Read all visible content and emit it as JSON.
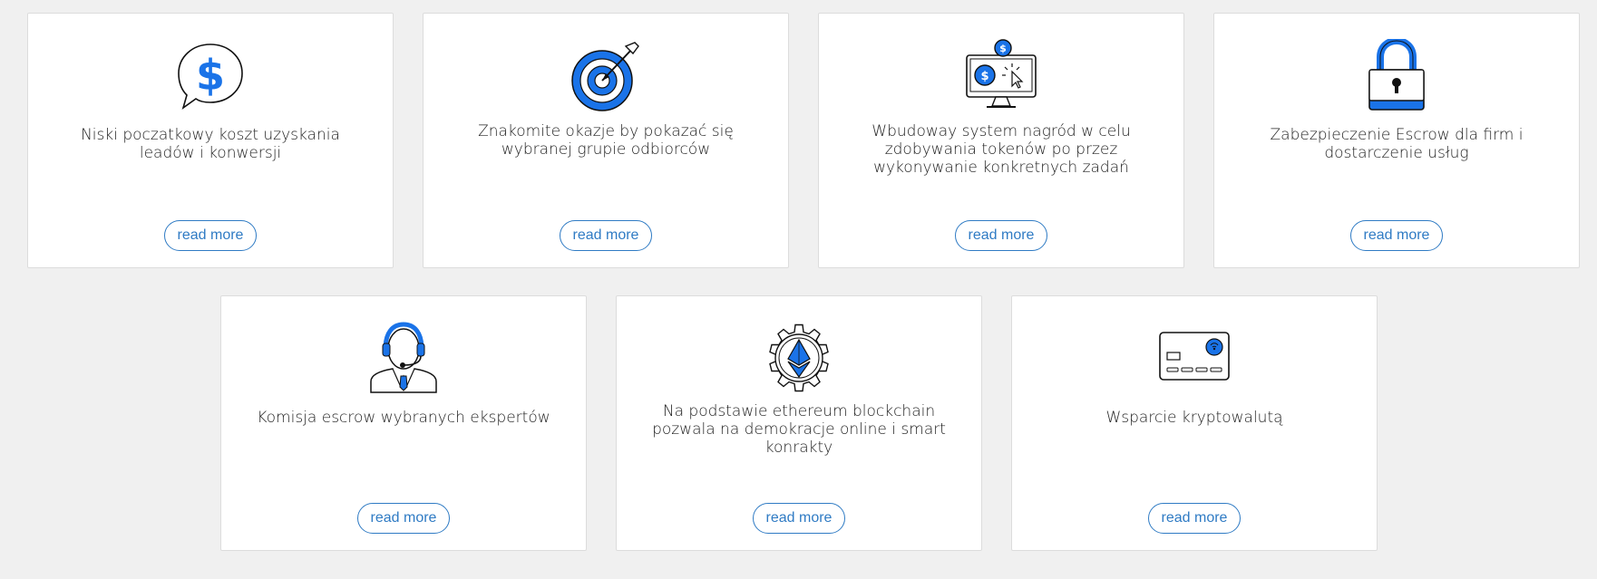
{
  "colors": {
    "accent": "#1a73e8",
    "button_text": "#2f7bc4",
    "background": "#f0f0f0"
  },
  "cards": [
    {
      "icon": "dollar-speech-bubble-icon",
      "text": "Niski poczatkowy koszt uzyskania leadów i konwersji",
      "button": "read more"
    },
    {
      "icon": "target-arrow-icon",
      "text": "Znakomite okazje by pokazać się wybranej grupie odbiorców",
      "button": "read more"
    },
    {
      "icon": "monitor-coins-icon",
      "text": "Wbudoway system nagród w celu zdobywania tokenów po przez wykonywanie konkretnych zadań",
      "button": "read more"
    },
    {
      "icon": "padlock-icon",
      "text": "Zabezpieczenie Escrow dla firm i dostarczenie usług",
      "button": "read more"
    },
    {
      "icon": "support-agent-headset-icon",
      "text": "Komisja escrow wybranych ekspertów",
      "button": "read more"
    },
    {
      "icon": "ethereum-gear-icon",
      "text": "Na podstawie ethereum blockchain pozwala na demokracje online i smart konrakty",
      "button": "read more"
    },
    {
      "icon": "credit-card-icon",
      "text": "Wsparcie kryptowalutą",
      "button": "read more"
    }
  ]
}
